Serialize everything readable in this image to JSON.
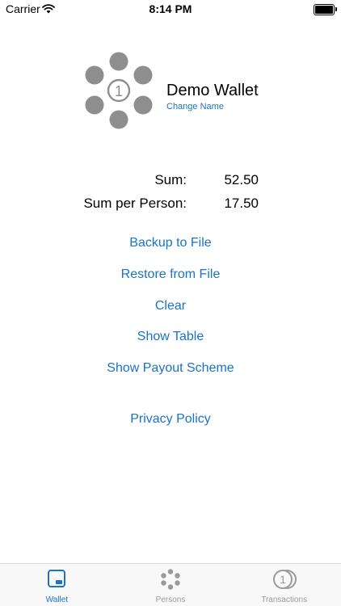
{
  "status_bar": {
    "carrier": "Carrier",
    "time": "8:14 PM",
    "icons": [
      "wifi-icon",
      "battery-icon"
    ]
  },
  "wallet": {
    "name": "Demo Wallet",
    "change_name_label": "Change Name",
    "logo_icon": "wallet-coins-logo",
    "logo_number": "1"
  },
  "summary": {
    "sum_label": "Sum:",
    "sum_value": "52.50",
    "per_person_label": "Sum per Person:",
    "per_person_value": "17.50"
  },
  "actions": {
    "backup": "Backup to File",
    "restore": "Restore from File",
    "clear": "Clear",
    "show_table": "Show Table",
    "payout_scheme": "Show Payout Scheme",
    "privacy": "Privacy Policy"
  },
  "tabs": [
    {
      "label": "Wallet",
      "icon": "wallet-icon",
      "active": true
    },
    {
      "label": "Persons",
      "icon": "persons-icon",
      "active": false
    },
    {
      "label": "Transactions",
      "icon": "coin-icon",
      "active": false
    }
  ],
  "colors": {
    "accent": "#1a73c8",
    "logo_gray": "#8e8e8e",
    "inactive_tab": "#999999"
  }
}
